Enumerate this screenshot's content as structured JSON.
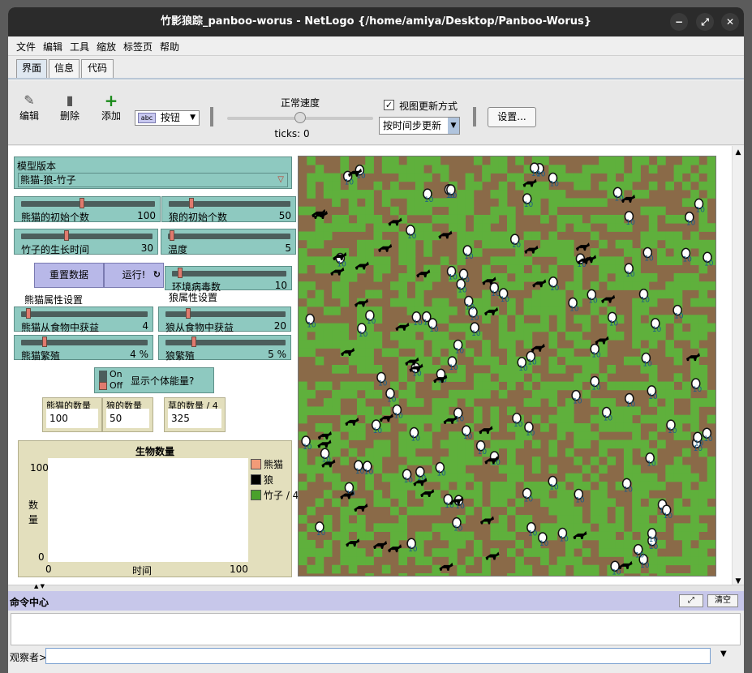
{
  "window": {
    "title": "竹影狼踪_panboo-worus - NetLogo {/home/amiya/Desktop/Panboo-Worus}",
    "controls": [
      "−",
      "⤢",
      "✕"
    ]
  },
  "menu": [
    "文件",
    "编辑",
    "工具",
    "缩放",
    "标签页",
    "帮助"
  ],
  "tabs": [
    "界面",
    "信息",
    "代码"
  ],
  "toolbar": {
    "edit": "编辑",
    "delete": "删除",
    "add": "添加",
    "widget_type": "按钮",
    "widget_icon_text": "abc",
    "speed_label": "正常速度",
    "ticks": "ticks: 0",
    "view_updates_label": "视图更新方式",
    "view_updates_checked": true,
    "update_mode": "按时间步更新",
    "settings": "设置..."
  },
  "widgets": {
    "chooser": {
      "label": "模型版本",
      "value": "熊猫-狼-竹子"
    },
    "sliders": [
      {
        "label": "熊猫的初始个数",
        "value": "100",
        "level": 0.5
      },
      {
        "label": "狼的初始个数",
        "value": "50",
        "level": 0.25
      },
      {
        "label": "竹子的生长时间",
        "value": "30",
        "level": 0.3
      },
      {
        "label": "温度",
        "value": "5",
        "level": 0.05
      },
      {
        "label": "环境病毒数",
        "value": "10",
        "level": 0.1
      },
      {
        "label": "熊猫从食物中获益",
        "value": "4",
        "level": 0.04
      },
      {
        "label": "狼从食物中获益",
        "value": "20",
        "level": 0.2
      },
      {
        "label": "熊猫繁殖",
        "value": "4 %",
        "level": 0.2
      },
      {
        "label": "狼繁殖",
        "value": "5 %",
        "level": 0.25
      }
    ],
    "buttons": {
      "setup": "重置数据",
      "go": "运行!",
      "go_icon": "↻"
    },
    "sections": {
      "panda": "熊猫属性设置",
      "wolf": "狼属性设置"
    },
    "switch": {
      "on": "On",
      "off": "Off",
      "label": "显示个体能量?"
    },
    "monitors": [
      {
        "label": "熊猫的数量",
        "value": "100"
      },
      {
        "label": "狼的数量",
        "value": "50"
      },
      {
        "label": "草的数量 / 4",
        "value": "325"
      }
    ]
  },
  "chart_data": {
    "type": "line",
    "title": "生物数量",
    "xlabel": "时间",
    "ylabel": "数量",
    "xlim": [
      0,
      100
    ],
    "ylim": [
      0,
      100
    ],
    "x_ticks": [
      "0",
      "100"
    ],
    "y_ticks": [
      "0",
      "100"
    ],
    "grid": false,
    "legend_position": "right",
    "series": [
      {
        "name": "熊猫",
        "color": "#f29b78",
        "values": []
      },
      {
        "name": "狼",
        "color": "#000000",
        "values": []
      },
      {
        "name": "竹子 / 4",
        "color": "#4aa12c",
        "values": []
      }
    ]
  },
  "world": {
    "ground_color": "#8a6a48",
    "grass_color": "#5fb03c",
    "panda_energy": "10"
  },
  "command_center": {
    "title": "命令中心",
    "clear": "清空",
    "observer": "观察者>",
    "input_value": ""
  }
}
